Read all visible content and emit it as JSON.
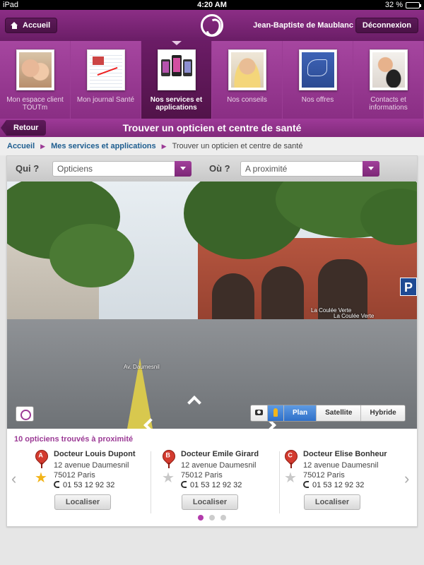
{
  "status": {
    "device": "iPad",
    "time": "4:20 AM",
    "battery": "32 %",
    "battery_fraction": 0.32
  },
  "header": {
    "home_label": "Accueil",
    "user_name": "Jean-Baptiste de Maublanc",
    "logout_label": "Déconnexion"
  },
  "nav": {
    "tiles": [
      {
        "label": "Mon espace client TOUTm"
      },
      {
        "label": "Mon journal Santé"
      },
      {
        "label": "Nos services et applications"
      },
      {
        "label": "Nos conseils"
      },
      {
        "label": "Nos offres"
      },
      {
        "label": "Contacts et informations"
      }
    ]
  },
  "titlebar": {
    "back_label": "Retour",
    "title": "Trouver un opticien et centre de santé"
  },
  "breadcrumb": {
    "items": [
      "Accueil",
      "Mes services et applications"
    ],
    "current": "Trouver un opticien et centre de santé"
  },
  "filters": {
    "qui_label": "Qui ?",
    "qui_value": "Opticiens",
    "ou_label": "Où ?",
    "ou_value": "A proximité"
  },
  "map": {
    "street_label": "Av. Daumesnil",
    "place_label_1": "La Coulée Verte",
    "place_label_2": "La Coulée Verte",
    "parking_sign": "P",
    "types": [
      "Plan",
      "Satellite",
      "Hybride"
    ],
    "selected_type": "Plan"
  },
  "results": {
    "title": "10 opticiens trouvés à proximité",
    "items": [
      {
        "marker": "A",
        "name": "Docteur Louis Dupont",
        "street": "12 avenue Daumesnil",
        "city": "75012 Paris",
        "phone": "01 53 12 92 32",
        "favorite": true,
        "action": "Localiser"
      },
      {
        "marker": "B",
        "name": "Docteur Emile Girard",
        "street": "12 avenue Daumesnil",
        "city": "75012 Paris",
        "phone": "01 53 12 92 32",
        "favorite": false,
        "action": "Localiser"
      },
      {
        "marker": "C",
        "name": "Docteur Elise Bonheur",
        "street": "12 avenue Daumesnil",
        "city": "75012 Paris",
        "phone": "01 53 12 92 32",
        "favorite": false,
        "action": "Localiser"
      }
    ],
    "prev_arrow": "‹",
    "next_arrow": "›",
    "pages": 3,
    "current_page": 1
  },
  "colors": {
    "brand": "#8c2e86",
    "accent": "#9b3a95",
    "link": "#1d5d8f",
    "map_selected": "#2f70c9"
  }
}
